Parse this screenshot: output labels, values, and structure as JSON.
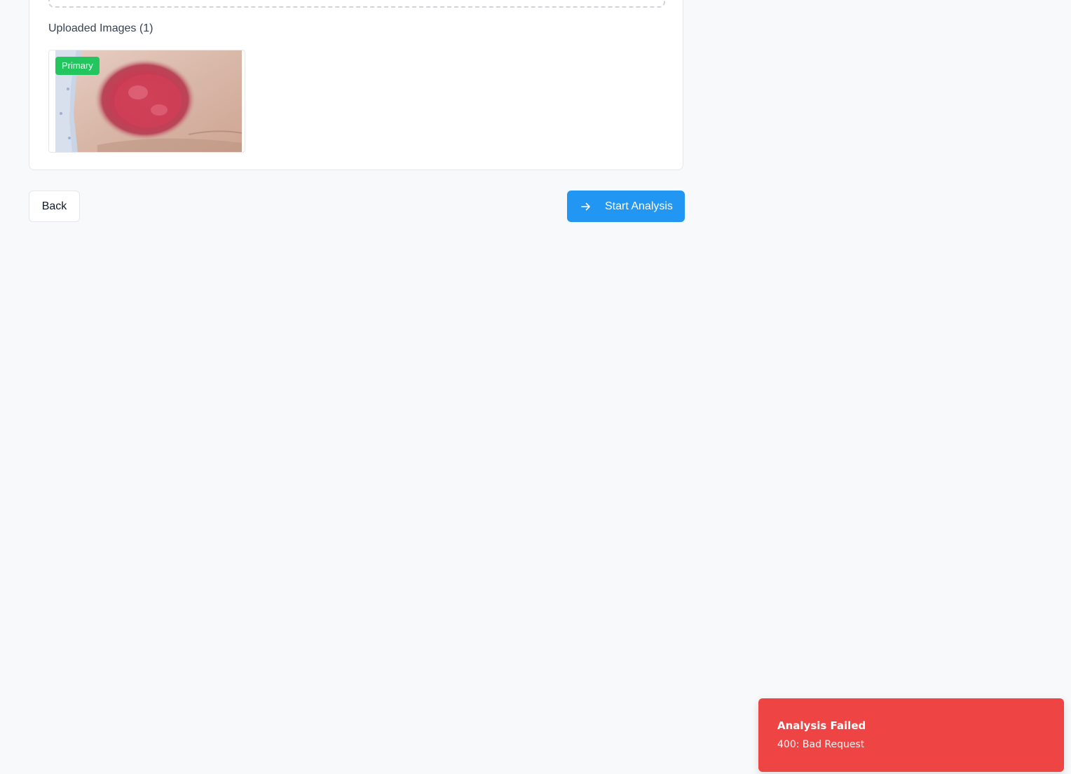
{
  "upload": {
    "heading": "Uploaded Images (1)",
    "images": [
      {
        "badge": "Primary",
        "alt": "wound-photo"
      }
    ]
  },
  "actions": {
    "back_label": "Back",
    "start_label": "Start Analysis",
    "start_icon": "arrow-right-icon"
  },
  "toast": {
    "title": "Analysis Failed",
    "message": "400: Bad Request"
  },
  "colors": {
    "primary": "#2196f3",
    "success": "#22c55e",
    "danger": "#ef4444",
    "background": "#f8f9fb"
  }
}
